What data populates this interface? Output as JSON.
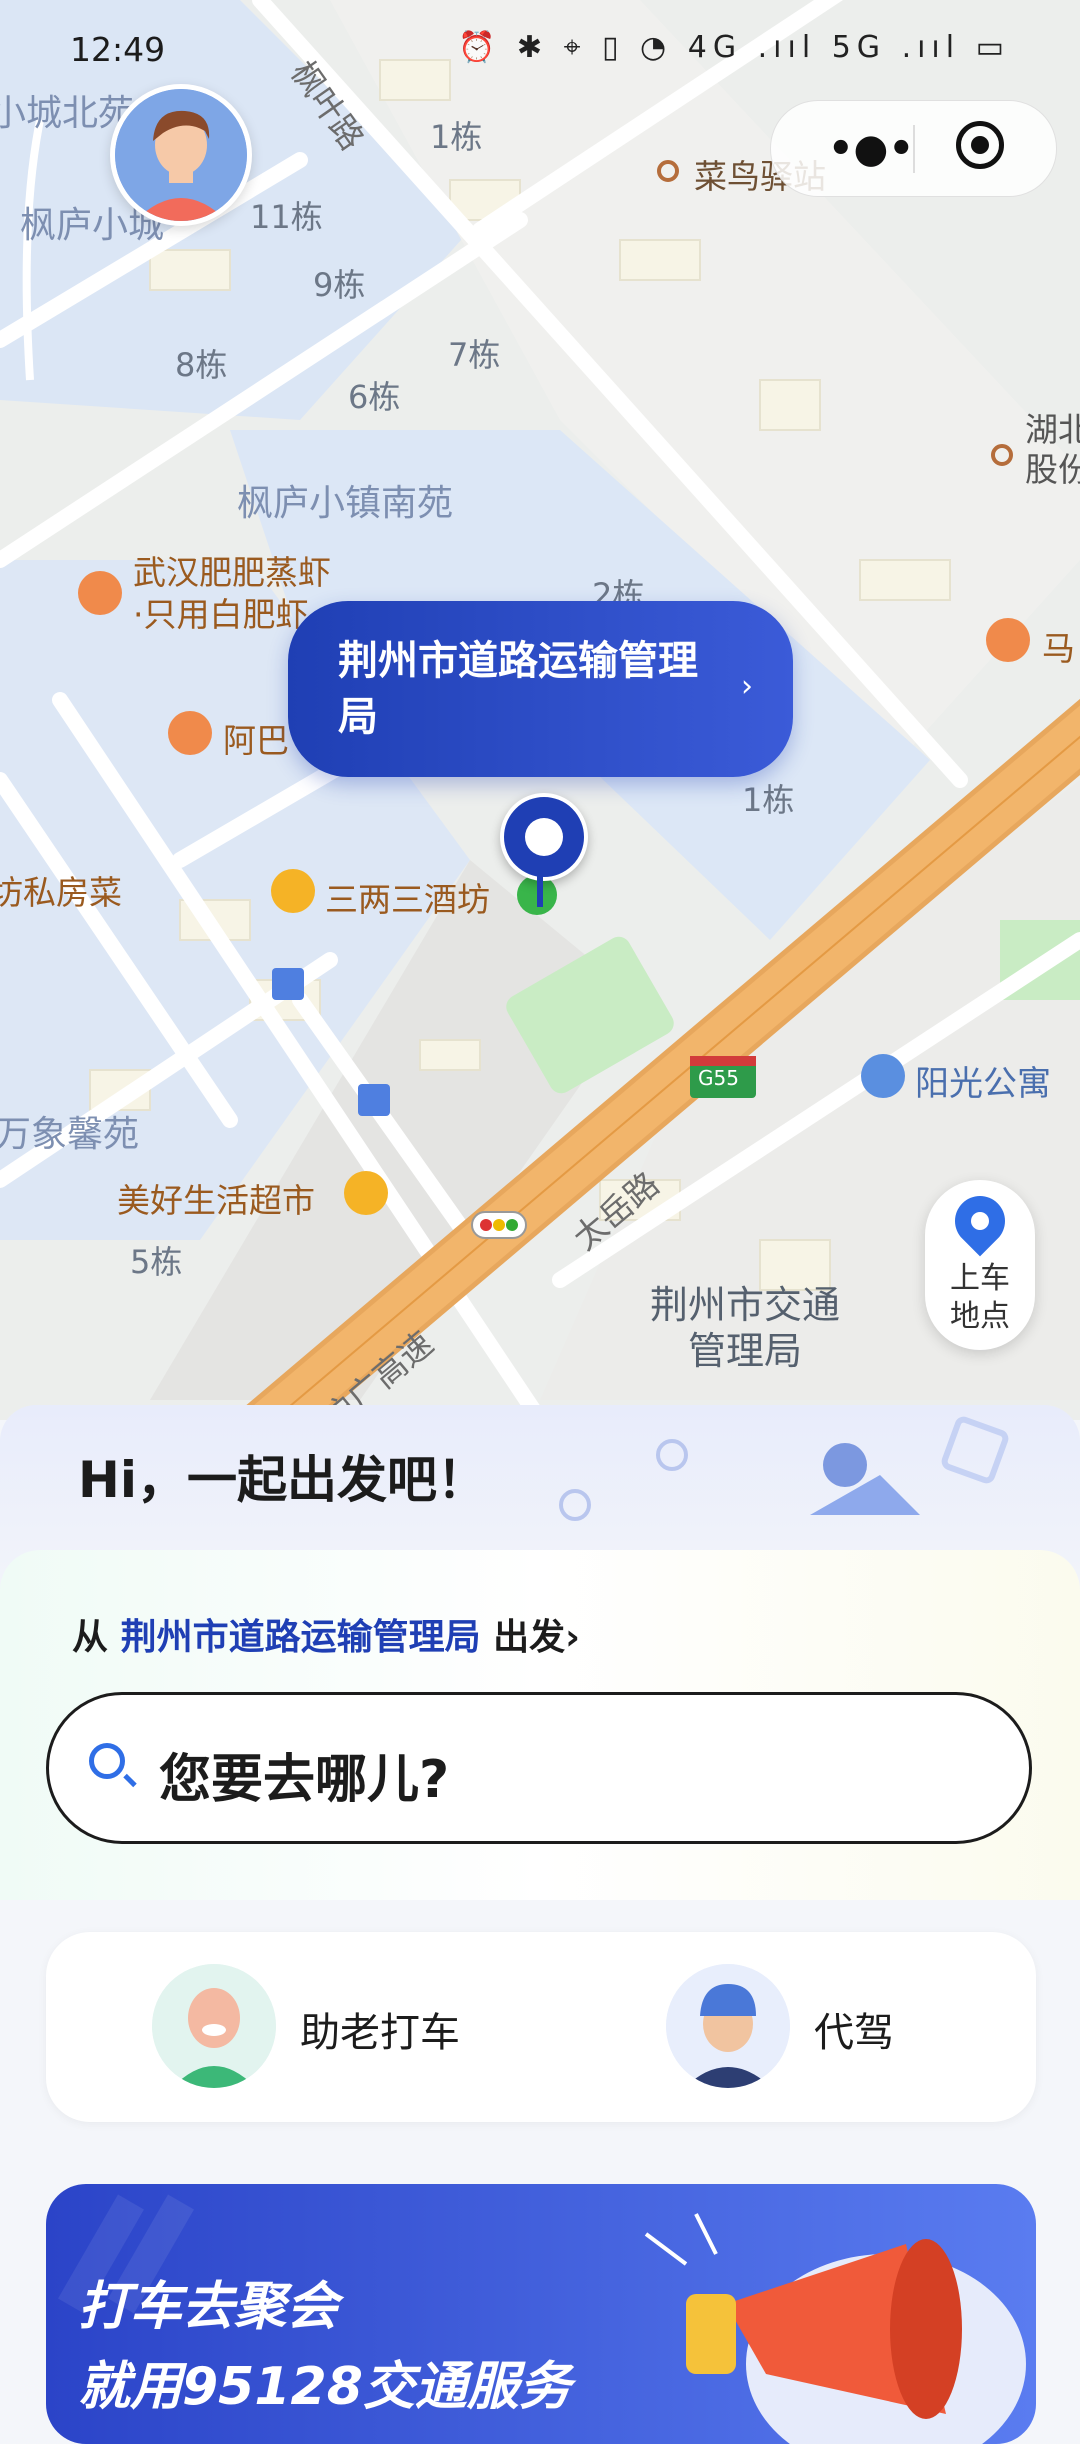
{
  "status_bar": {
    "time": "12:49",
    "icons": "⏰ ✱ ⌖ ▯ ◔ 4G .ııl 5G .ııl ▭"
  },
  "map": {
    "districts": [
      "枫庐小城",
      "小城北苑",
      "枫庐小镇南苑",
      "万象馨苑",
      "坊私房菜"
    ],
    "buildings": [
      "1栋",
      "11栋",
      "9栋",
      "8栋",
      "7栋",
      "6栋",
      "2栋",
      "1栋",
      "5栋"
    ],
    "roads": [
      "枫叶路",
      "太岳路",
      "沪广高速",
      "G55"
    ],
    "pois": {
      "cainiao": "菜鸟驿站",
      "hubei": "湖北\n股份",
      "wuhan": "武汉肥肥蒸虾\n·只用白肥虾",
      "aba": "阿巴",
      "sanliang": "三两三酒坊",
      "yangguang": "阳光公寓",
      "meihao": "美好生活超市",
      "ma": "马",
      "jiaotong": "荆州市交通\n管理局"
    },
    "bubble_title": "荆州市道路运输管理局",
    "pickup_label": "上车\n地点"
  },
  "sheet": {
    "greeting": "Hi，一起出发吧！",
    "from_prefix": "从",
    "from_place": "荆州市道路运输管理局",
    "from_suffix": "出发›",
    "search_placeholder": "您要去哪儿?",
    "services": [
      {
        "label": "助老打车"
      },
      {
        "label": "代驾"
      }
    ],
    "banner": {
      "line1": "打车去聚会",
      "line2": "就用95128交通服务"
    }
  },
  "colors": {
    "brand": "#1f3fb4",
    "accent": "#2f6ee6",
    "highway": "#f2b56b"
  }
}
